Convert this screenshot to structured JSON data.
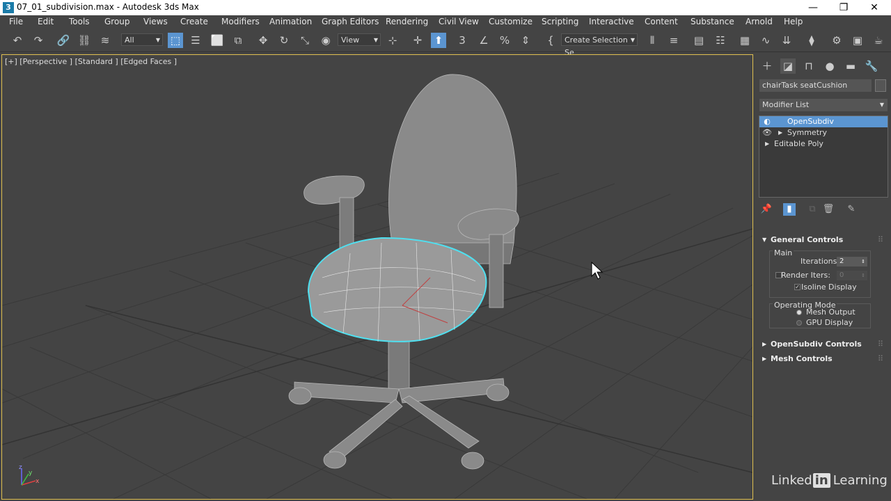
{
  "window": {
    "app_icon": "3",
    "title": "07_01_subdivision.max - Autodesk 3ds Max",
    "minimize": "—",
    "restore": "❐",
    "close": "✕"
  },
  "menu": [
    "File",
    "Edit",
    "Tools",
    "Group",
    "Views",
    "Create",
    "Modifiers",
    "Animation",
    "Graph Editors",
    "Rendering",
    "Civil View",
    "Customize",
    "Scripting",
    "Interactive",
    "Content",
    "Substance",
    "Arnold",
    "Help"
  ],
  "toolbar": {
    "selection_filter": "All",
    "reference_coord": "View",
    "named_selection": "Create Selection Se"
  },
  "viewport": {
    "label": "[+] [Perspective ] [Standard ] [Edged Faces ]",
    "axis_x": "x",
    "axis_y": "y",
    "axis_z": "z"
  },
  "command_panel": {
    "object_name": "chairTask seatCushion",
    "modifier_list": "Modifier List",
    "stack": [
      {
        "label": "OpenSubdiv",
        "selected": true
      },
      {
        "label": "Symmetry",
        "selected": false
      },
      {
        "label": "Editable Poly",
        "selected": false
      }
    ]
  },
  "general_controls": {
    "title": "General Controls",
    "main_label": "Main",
    "iterations_label": "Iterations:",
    "iterations_value": "2",
    "render_iters_label": "Render Iters:",
    "render_iters_value": "0",
    "isoline_label": "Isoline Display",
    "check_mark": "✓",
    "operating_mode_label": "Operating Mode",
    "mesh_output_label": "Mesh Output",
    "gpu_display_label": "GPU Display"
  },
  "rollouts": {
    "opensubdiv_controls": "OpenSubdiv Controls",
    "mesh_controls": "Mesh Controls"
  },
  "watermark": {
    "brand_text": "Linked",
    "brand_box": "in",
    "suffix": "Learning"
  },
  "colors": {
    "accent": "#5b95d1",
    "selection_outline": "#4fe0f0",
    "viewport_border": "#e0c050"
  }
}
